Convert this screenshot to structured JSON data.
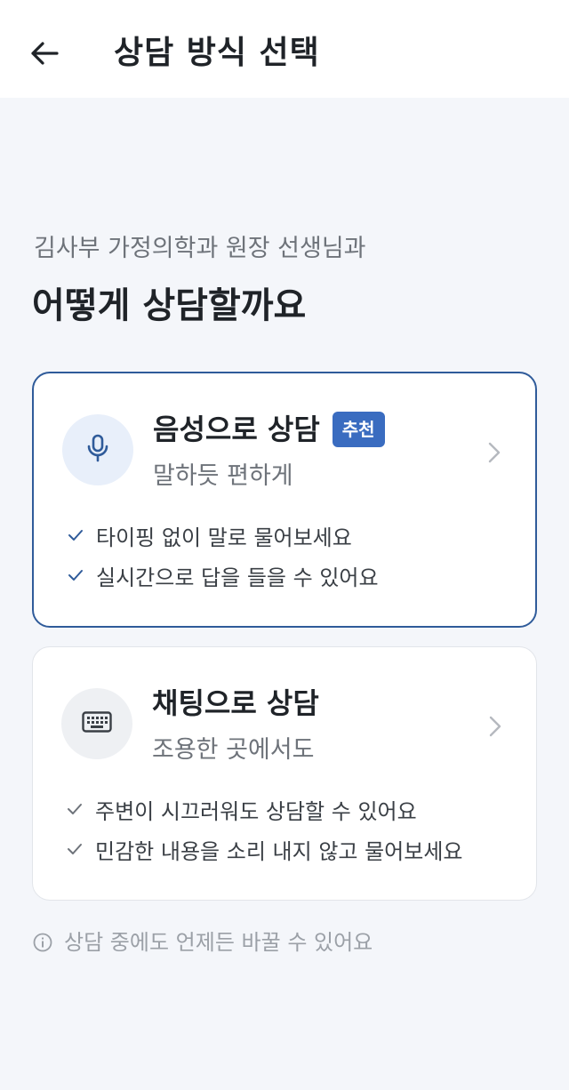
{
  "header": {
    "back_icon": "arrow-left-icon",
    "title": "상담 방식 선택"
  },
  "intro": {
    "subtitle": "김사부 가정의학과 원장 선생님과",
    "title": "어떻게 상담할까요"
  },
  "options": [
    {
      "icon": "microphone-icon",
      "title": "음성으로 상담",
      "badge": "추천",
      "description": "말하듯 편하게",
      "selected": true,
      "features": [
        "타이핑 없이 말로 물어보세요",
        "실시간으로 답을 들을 수 있어요"
      ]
    },
    {
      "icon": "keyboard-icon",
      "title": "채팅으로 상담",
      "description": "조용한 곳에서도",
      "selected": false,
      "features": [
        "주변이 시끄러워도 상담할 수 있어요",
        "민감한 내용을 소리 내지 않고 물어보세요"
      ]
    }
  ],
  "footnote": {
    "icon": "info-icon",
    "text": "상담 중에도 언제든 바꿀 수 있어요"
  },
  "colors": {
    "accent": "#2f5b9a",
    "badge": "#3a6cc0",
    "background": "#f4f6fa"
  }
}
